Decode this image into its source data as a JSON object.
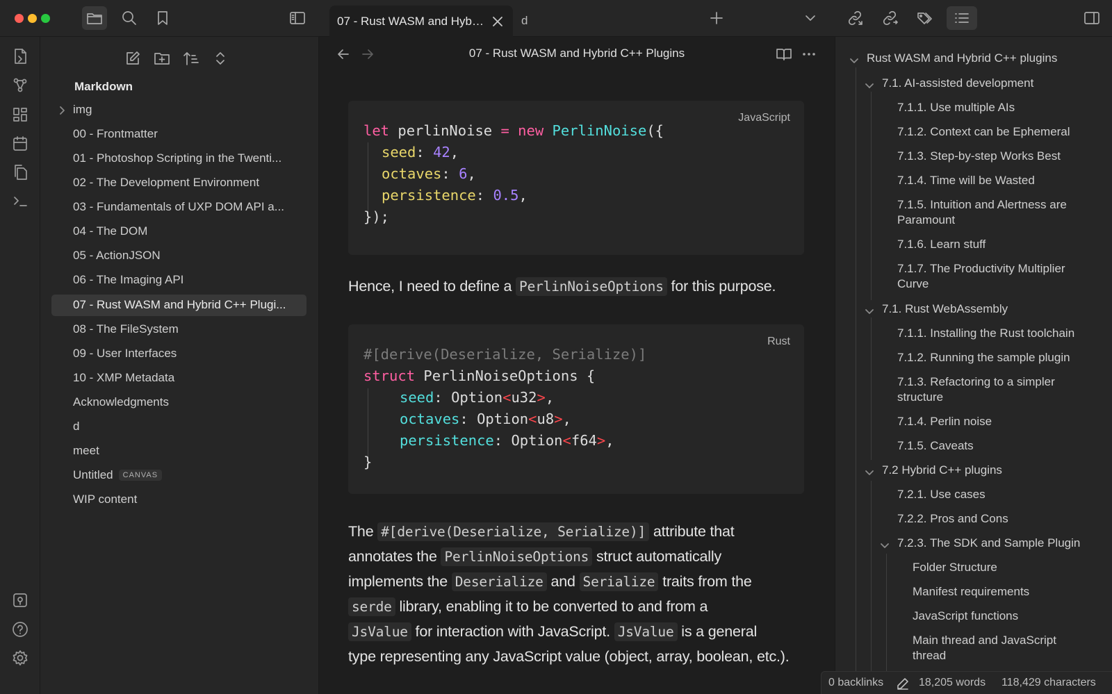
{
  "window": {
    "traffic_lights": {
      "close": "#fe5f57",
      "minimize": "#febc2e",
      "zoom": "#28c840"
    }
  },
  "topbar": {
    "left_icons": [
      "folder-icon",
      "search-icon",
      "bookmark-icon",
      "sidebar-toggle-icon"
    ],
    "tabs": [
      {
        "label": "07 - Rust WASM and Hyb…",
        "active": true
      },
      {
        "label": "d",
        "active": false
      }
    ],
    "right_icons": [
      "new-tab-icon",
      "tab-list-chevron-icon",
      "backlinks-icon",
      "outgoing-links-icon",
      "tags-icon",
      "outline-icon",
      "right-sidebar-toggle-icon"
    ]
  },
  "ribbon": {
    "top_icons": [
      "open-quick-switcher-icon",
      "graph-view-icon",
      "canvas-icon",
      "daily-note-icon",
      "templates-icon",
      "command-palette-icon"
    ],
    "bottom_icons": [
      "vault-switch-icon",
      "help-icon",
      "settings-icon"
    ]
  },
  "explorer": {
    "toolbar_icons": [
      "new-note-icon",
      "new-folder-icon",
      "sort-icon",
      "collapse-all-icon"
    ],
    "vault_name": "Markdown",
    "items": [
      {
        "label": "img",
        "folder": true
      },
      {
        "label": "00 - Frontmatter"
      },
      {
        "label": "01 - Photoshop Scripting in the Twenti..."
      },
      {
        "label": "02 - The Development Environment"
      },
      {
        "label": "03 - Fundamentals of UXP DOM API a..."
      },
      {
        "label": "04 - The DOM"
      },
      {
        "label": "05 - ActionJSON"
      },
      {
        "label": "06 - The Imaging API"
      },
      {
        "label": "07 - Rust WASM and Hybrid C++ Plugi...",
        "selected": true
      },
      {
        "label": "08 - The FileSystem"
      },
      {
        "label": "09 - User Interfaces"
      },
      {
        "label": "10 - XMP Metadata"
      },
      {
        "label": "Acknowledgments"
      },
      {
        "label": "d"
      },
      {
        "label": "meet"
      },
      {
        "label": "Untitled",
        "badge": "CANVAS"
      },
      {
        "label": "WIP content"
      }
    ]
  },
  "editor": {
    "title": "07 - Rust WASM and Hybrid C++ Plugins",
    "code1": {
      "lang": "JavaScript",
      "l1": {
        "let": "let",
        "name": " perlinNoise ",
        "eq": "=",
        "new": " new ",
        "cls": "PerlinNoise",
        "open": "({"
      },
      "l2": {
        "key": "seed",
        "colon": ": ",
        "val": "42",
        "comma": ","
      },
      "l3": {
        "key": "octaves",
        "colon": ": ",
        "val": "6",
        "comma": ","
      },
      "l4": {
        "key": "persistence",
        "colon": ": ",
        "val": "0.5",
        "comma": ","
      },
      "l5": "});"
    },
    "para1": {
      "before": "Hence, I need to define a ",
      "code": "PerlinNoiseOptions",
      "after": " for this purpose."
    },
    "code2": {
      "lang": "Rust",
      "l1": "#[derive(Deserialize, Serialize)]",
      "l2": {
        "kw": "struct",
        "name": " PerlinNoiseOptions {"
      },
      "l3": {
        "key": "seed",
        "colon": ": ",
        "type": "Option",
        "lt": "<",
        "inner": "u32",
        "gt": ">",
        "comma": ","
      },
      "l4": {
        "key": "octaves",
        "colon": ": ",
        "type": "Option",
        "lt": "<",
        "inner": "u8",
        "gt": ">",
        "comma": ","
      },
      "l5": {
        "key": "persistence",
        "colon": ": ",
        "type": "Option",
        "lt": "<",
        "inner": "f64",
        "gt": ">",
        "comma": ","
      },
      "l6": "}"
    },
    "para2": {
      "l1a": "The ",
      "l1code": "#[derive(Deserialize, Serialize)]",
      "l1b": " attribute that",
      "l2a": "annotates the ",
      "l2code": "PerlinNoiseOptions",
      "l2b": " struct automatically",
      "l3a": "implements the ",
      "l3code1": "Deserialize",
      "l3mid": " and ",
      "l3code2": "Serialize",
      "l3b": " traits from the",
      "l4code": "serde",
      "l4b": " library, enabling it to be converted to and from a",
      "l5code": "JsValue",
      "l5b": " for interaction with JavaScript. ",
      "l5code2": "JsValue",
      "l5c": " is a general",
      "l6": "type representing any JavaScript value (object, array, boolean, etc.)."
    }
  },
  "outline": {
    "items": [
      {
        "label": "Rust WASM and Hybrid C++ plugins",
        "level": 1,
        "collapsible": true
      },
      {
        "label": "7.1. AI-assisted development",
        "level": 2,
        "collapsible": true
      },
      {
        "label": "7.1.1. Use multiple AIs",
        "level": 3
      },
      {
        "label": "7.1.2. Context can be Ephemeral",
        "level": 3
      },
      {
        "label": "7.1.3. Step-by-step Works Best",
        "level": 3
      },
      {
        "label": "7.1.4. Time will be Wasted",
        "level": 3
      },
      {
        "label": "7.1.5. Intuition and Alertness are",
        "label2": "Paramount",
        "level": 3
      },
      {
        "label": "7.1.6. Learn stuff",
        "level": 3
      },
      {
        "label": "7.1.7. The Productivity Multiplier",
        "label2": "Curve",
        "level": 3
      },
      {
        "label": "7.1. Rust WebAssembly",
        "level": 2,
        "collapsible": true
      },
      {
        "label": "7.1.1. Installing the Rust toolchain",
        "level": 3
      },
      {
        "label": "7.1.2. Running the sample plugin",
        "level": 3
      },
      {
        "label": "7.1.3. Refactoring to a simpler",
        "label2": "structure",
        "level": 3
      },
      {
        "label": "7.1.4. Perlin noise",
        "level": 3
      },
      {
        "label": "7.1.5. Caveats",
        "level": 3
      },
      {
        "label": "7.2 Hybrid C++ plugins",
        "level": 2,
        "collapsible": true
      },
      {
        "label": "7.2.1. Use cases",
        "level": 3
      },
      {
        "label": "7.2.2. Pros and Cons",
        "level": 3
      },
      {
        "label": "7.2.3. The SDK and Sample Plugin",
        "level": 3,
        "collapsible": true
      },
      {
        "label": "Folder Structure",
        "level": 4
      },
      {
        "label": "Manifest requirements",
        "level": 4
      },
      {
        "label": "JavaScript functions",
        "level": 4
      },
      {
        "label": "Main thread and JavaScript",
        "label2": "thread",
        "level": 4
      }
    ]
  },
  "statusbar": {
    "backlinks": "0 backlinks",
    "words": "18,205 words",
    "characters": "118,429 characters"
  }
}
